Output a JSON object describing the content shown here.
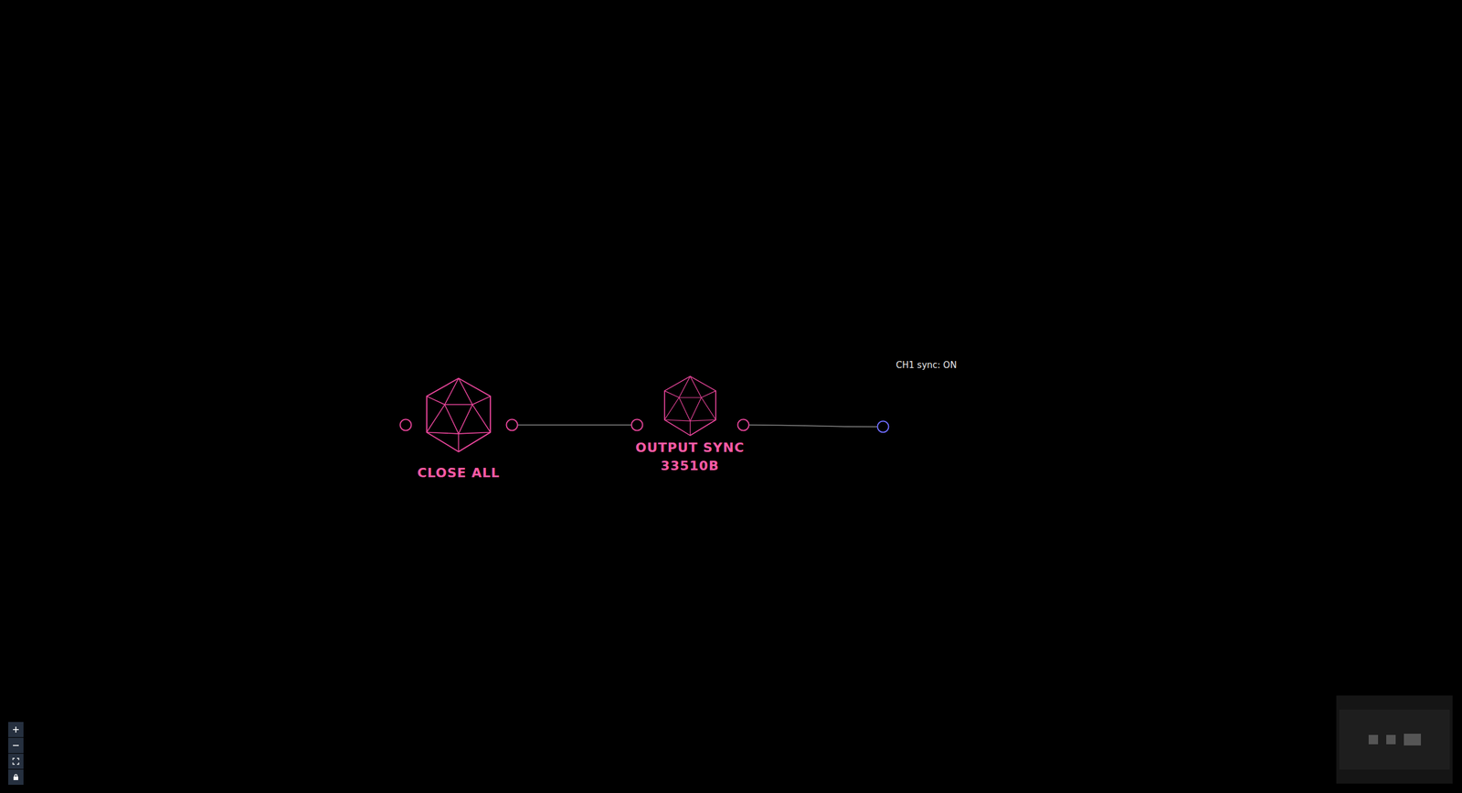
{
  "canvas": {
    "nodes": [
      {
        "label_lines": [
          "CLOSE ALL"
        ]
      },
      {
        "label_lines": [
          "OUTPUT SYNC",
          "33510B"
        ]
      }
    ],
    "terminal": {
      "annotation": "CH1 sync: ON"
    },
    "edges": [
      {
        "from": 0,
        "to": 1
      },
      {
        "from": 1,
        "to": "terminal"
      }
    ]
  },
  "controls": {
    "buttons": [
      {
        "icon": "zoom-in"
      },
      {
        "icon": "zoom-out"
      },
      {
        "icon": "fit-view"
      },
      {
        "icon": "lock"
      }
    ]
  },
  "minimap": {
    "nodes": 3
  }
}
